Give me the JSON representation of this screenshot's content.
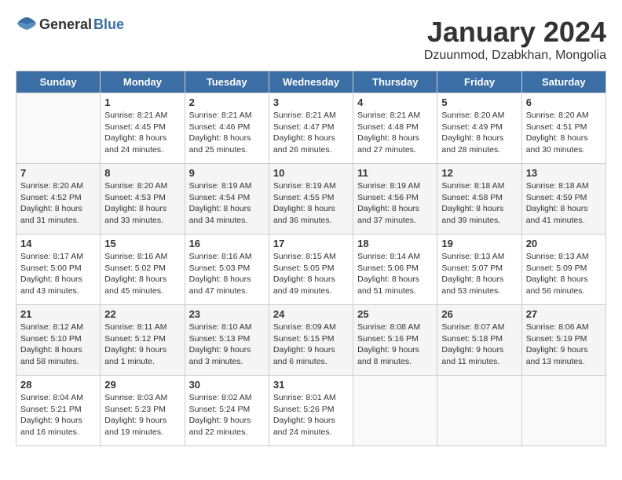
{
  "logo": {
    "general": "General",
    "blue": "Blue"
  },
  "title": "January 2024",
  "subtitle": "Dzuunmod, Dzabkhan, Mongolia",
  "days": [
    "Sunday",
    "Monday",
    "Tuesday",
    "Wednesday",
    "Thursday",
    "Friday",
    "Saturday"
  ],
  "weeks": [
    [
      {
        "num": "",
        "sunrise": "",
        "sunset": "",
        "daylight": ""
      },
      {
        "num": "1",
        "sunrise": "Sunrise: 8:21 AM",
        "sunset": "Sunset: 4:45 PM",
        "daylight": "Daylight: 8 hours and 24 minutes."
      },
      {
        "num": "2",
        "sunrise": "Sunrise: 8:21 AM",
        "sunset": "Sunset: 4:46 PM",
        "daylight": "Daylight: 8 hours and 25 minutes."
      },
      {
        "num": "3",
        "sunrise": "Sunrise: 8:21 AM",
        "sunset": "Sunset: 4:47 PM",
        "daylight": "Daylight: 8 hours and 26 minutes."
      },
      {
        "num": "4",
        "sunrise": "Sunrise: 8:21 AM",
        "sunset": "Sunset: 4:48 PM",
        "daylight": "Daylight: 8 hours and 27 minutes."
      },
      {
        "num": "5",
        "sunrise": "Sunrise: 8:20 AM",
        "sunset": "Sunset: 4:49 PM",
        "daylight": "Daylight: 8 hours and 28 minutes."
      },
      {
        "num": "6",
        "sunrise": "Sunrise: 8:20 AM",
        "sunset": "Sunset: 4:51 PM",
        "daylight": "Daylight: 8 hours and 30 minutes."
      }
    ],
    [
      {
        "num": "7",
        "sunrise": "Sunrise: 8:20 AM",
        "sunset": "Sunset: 4:52 PM",
        "daylight": "Daylight: 8 hours and 31 minutes."
      },
      {
        "num": "8",
        "sunrise": "Sunrise: 8:20 AM",
        "sunset": "Sunset: 4:53 PM",
        "daylight": "Daylight: 8 hours and 33 minutes."
      },
      {
        "num": "9",
        "sunrise": "Sunrise: 8:19 AM",
        "sunset": "Sunset: 4:54 PM",
        "daylight": "Daylight: 8 hours and 34 minutes."
      },
      {
        "num": "10",
        "sunrise": "Sunrise: 8:19 AM",
        "sunset": "Sunset: 4:55 PM",
        "daylight": "Daylight: 8 hours and 36 minutes."
      },
      {
        "num": "11",
        "sunrise": "Sunrise: 8:19 AM",
        "sunset": "Sunset: 4:56 PM",
        "daylight": "Daylight: 8 hours and 37 minutes."
      },
      {
        "num": "12",
        "sunrise": "Sunrise: 8:18 AM",
        "sunset": "Sunset: 4:58 PM",
        "daylight": "Daylight: 8 hours and 39 minutes."
      },
      {
        "num": "13",
        "sunrise": "Sunrise: 8:18 AM",
        "sunset": "Sunset: 4:59 PM",
        "daylight": "Daylight: 8 hours and 41 minutes."
      }
    ],
    [
      {
        "num": "14",
        "sunrise": "Sunrise: 8:17 AM",
        "sunset": "Sunset: 5:00 PM",
        "daylight": "Daylight: 8 hours and 43 minutes."
      },
      {
        "num": "15",
        "sunrise": "Sunrise: 8:16 AM",
        "sunset": "Sunset: 5:02 PM",
        "daylight": "Daylight: 8 hours and 45 minutes."
      },
      {
        "num": "16",
        "sunrise": "Sunrise: 8:16 AM",
        "sunset": "Sunset: 5:03 PM",
        "daylight": "Daylight: 8 hours and 47 minutes."
      },
      {
        "num": "17",
        "sunrise": "Sunrise: 8:15 AM",
        "sunset": "Sunset: 5:05 PM",
        "daylight": "Daylight: 8 hours and 49 minutes."
      },
      {
        "num": "18",
        "sunrise": "Sunrise: 8:14 AM",
        "sunset": "Sunset: 5:06 PM",
        "daylight": "Daylight: 8 hours and 51 minutes."
      },
      {
        "num": "19",
        "sunrise": "Sunrise: 8:13 AM",
        "sunset": "Sunset: 5:07 PM",
        "daylight": "Daylight: 8 hours and 53 minutes."
      },
      {
        "num": "20",
        "sunrise": "Sunrise: 8:13 AM",
        "sunset": "Sunset: 5:09 PM",
        "daylight": "Daylight: 8 hours and 56 minutes."
      }
    ],
    [
      {
        "num": "21",
        "sunrise": "Sunrise: 8:12 AM",
        "sunset": "Sunset: 5:10 PM",
        "daylight": "Daylight: 8 hours and 58 minutes."
      },
      {
        "num": "22",
        "sunrise": "Sunrise: 8:11 AM",
        "sunset": "Sunset: 5:12 PM",
        "daylight": "Daylight: 9 hours and 1 minute."
      },
      {
        "num": "23",
        "sunrise": "Sunrise: 8:10 AM",
        "sunset": "Sunset: 5:13 PM",
        "daylight": "Daylight: 9 hours and 3 minutes."
      },
      {
        "num": "24",
        "sunrise": "Sunrise: 8:09 AM",
        "sunset": "Sunset: 5:15 PM",
        "daylight": "Daylight: 9 hours and 6 minutes."
      },
      {
        "num": "25",
        "sunrise": "Sunrise: 8:08 AM",
        "sunset": "Sunset: 5:16 PM",
        "daylight": "Daylight: 9 hours and 8 minutes."
      },
      {
        "num": "26",
        "sunrise": "Sunrise: 8:07 AM",
        "sunset": "Sunset: 5:18 PM",
        "daylight": "Daylight: 9 hours and 11 minutes."
      },
      {
        "num": "27",
        "sunrise": "Sunrise: 8:06 AM",
        "sunset": "Sunset: 5:19 PM",
        "daylight": "Daylight: 9 hours and 13 minutes."
      }
    ],
    [
      {
        "num": "28",
        "sunrise": "Sunrise: 8:04 AM",
        "sunset": "Sunset: 5:21 PM",
        "daylight": "Daylight: 9 hours and 16 minutes."
      },
      {
        "num": "29",
        "sunrise": "Sunrise: 8:03 AM",
        "sunset": "Sunset: 5:23 PM",
        "daylight": "Daylight: 9 hours and 19 minutes."
      },
      {
        "num": "30",
        "sunrise": "Sunrise: 8:02 AM",
        "sunset": "Sunset: 5:24 PM",
        "daylight": "Daylight: 9 hours and 22 minutes."
      },
      {
        "num": "31",
        "sunrise": "Sunrise: 8:01 AM",
        "sunset": "Sunset: 5:26 PM",
        "daylight": "Daylight: 9 hours and 24 minutes."
      },
      {
        "num": "",
        "sunrise": "",
        "sunset": "",
        "daylight": ""
      },
      {
        "num": "",
        "sunrise": "",
        "sunset": "",
        "daylight": ""
      },
      {
        "num": "",
        "sunrise": "",
        "sunset": "",
        "daylight": ""
      }
    ]
  ]
}
